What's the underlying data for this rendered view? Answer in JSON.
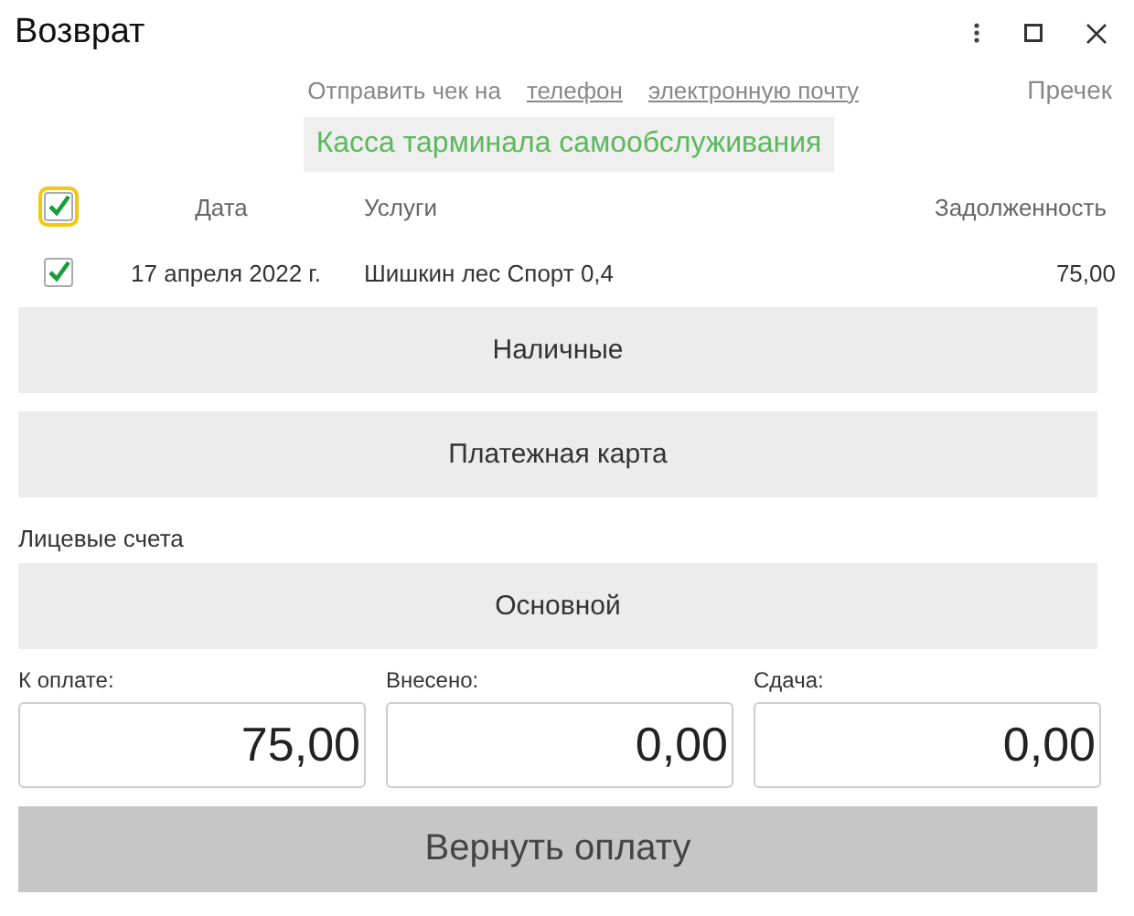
{
  "window": {
    "title": "Возврат"
  },
  "send_receipt": {
    "label": "Отправить чек на",
    "links": [
      "телефон",
      "электронную почту"
    ],
    "precheck": "Пречек"
  },
  "register": "Касса тарминала самообслуживания",
  "table": {
    "select_all": {
      "checked": true
    },
    "columns": [
      "Дата",
      "Услуги",
      "Задолженность"
    ],
    "rows": [
      {
        "checked": true,
        "date": "17 апреля 2022 г.",
        "service": "Шишкин лес Спорт 0,4",
        "debt": "75,00"
      }
    ]
  },
  "payment_buttons": [
    "Наличные",
    "Платежная карта"
  ],
  "accounts": {
    "label": "Лицевые счета",
    "button": "Основной"
  },
  "totals": [
    {
      "label": "К оплате:",
      "value": "75,00"
    },
    {
      "label": "Внесено:",
      "value": "0,00"
    },
    {
      "label": "Сдача:",
      "value": "0,00"
    }
  ],
  "submit": "Вернуть оплату"
}
